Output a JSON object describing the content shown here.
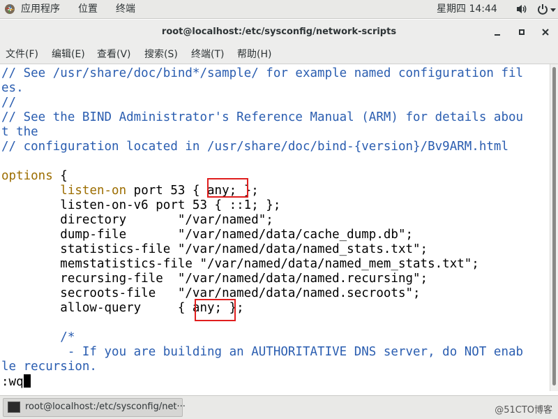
{
  "top_bar": {
    "applications_label": "应用程序",
    "places_label": "位置",
    "terminal_label": "终端",
    "clock": "星期四 14:44",
    "icons": [
      "apps-icon",
      "volume-icon",
      "power-icon",
      "chevron-down-icon"
    ]
  },
  "window": {
    "title": "root@localhost:/etc/sysconfig/network-scripts",
    "controls": [
      "minimize-icon",
      "maximize-icon",
      "close-icon"
    ]
  },
  "menu": {
    "items": [
      "文件(F)",
      "编辑(E)",
      "查看(V)",
      "搜索(S)",
      "终端(T)",
      "帮助(H)"
    ]
  },
  "terminal": {
    "lines": [
      [
        {
          "t": "// See /usr/share/doc/bind*/sample/ for example named configuration fil",
          "c": "comment"
        }
      ],
      [
        {
          "t": "es.",
          "c": "comment"
        }
      ],
      [
        {
          "t": "//",
          "c": "comment"
        }
      ],
      [
        {
          "t": "// See the BIND Administrator's Reference Manual (ARM) for details abou",
          "c": "comment"
        }
      ],
      [
        {
          "t": "t the",
          "c": "comment"
        }
      ],
      [
        {
          "t": "// configuration located in /usr/share/doc/bind-{version}/Bv9ARM.html",
          "c": "comment"
        }
      ],
      [
        {
          "t": "",
          "c": "normal"
        }
      ],
      [
        {
          "t": "options",
          "c": "keyword"
        },
        {
          "t": " {",
          "c": "normal"
        }
      ],
      [
        {
          "t": "        ",
          "c": "normal"
        },
        {
          "t": "listen-on",
          "c": "keyword"
        },
        {
          "t": " port 53 { any; };",
          "c": "normal"
        }
      ],
      [
        {
          "t": "        listen-on-v6 port 53 { ::1; };",
          "c": "normal"
        }
      ],
      [
        {
          "t": "        directory       \"/var/named\";",
          "c": "normal"
        }
      ],
      [
        {
          "t": "        dump-file       \"/var/named/data/cache_dump.db\";",
          "c": "normal"
        }
      ],
      [
        {
          "t": "        statistics-file \"/var/named/data/named_stats.txt\";",
          "c": "normal"
        }
      ],
      [
        {
          "t": "        memstatistics-file \"/var/named/data/named_mem_stats.txt\";",
          "c": "normal"
        }
      ],
      [
        {
          "t": "        recursing-file  \"/var/named/data/named.recursing\";",
          "c": "normal"
        }
      ],
      [
        {
          "t": "        secroots-file   \"/var/named/data/named.secroots\";",
          "c": "normal"
        }
      ],
      [
        {
          "t": "        allow-query     { any; };",
          "c": "normal"
        }
      ],
      [
        {
          "t": "",
          "c": "normal"
        }
      ],
      [
        {
          "t": "        /*",
          "c": "comment"
        }
      ],
      [
        {
          "t": "         - If you are building an AUTHORITATIVE DNS server, do NOT enab",
          "c": "comment"
        }
      ],
      [
        {
          "t": "le recursion.",
          "c": "comment"
        }
      ]
    ],
    "command": ":wq",
    "colors": {
      "comment": "#2a5db0",
      "keyword": "#9c6d00",
      "normal": "#000000",
      "highlight": "#e01e1e"
    }
  },
  "taskbar": {
    "task_label": "root@localhost:/etc/sysconfig/net···",
    "watermark": "@51CTO博客"
  }
}
